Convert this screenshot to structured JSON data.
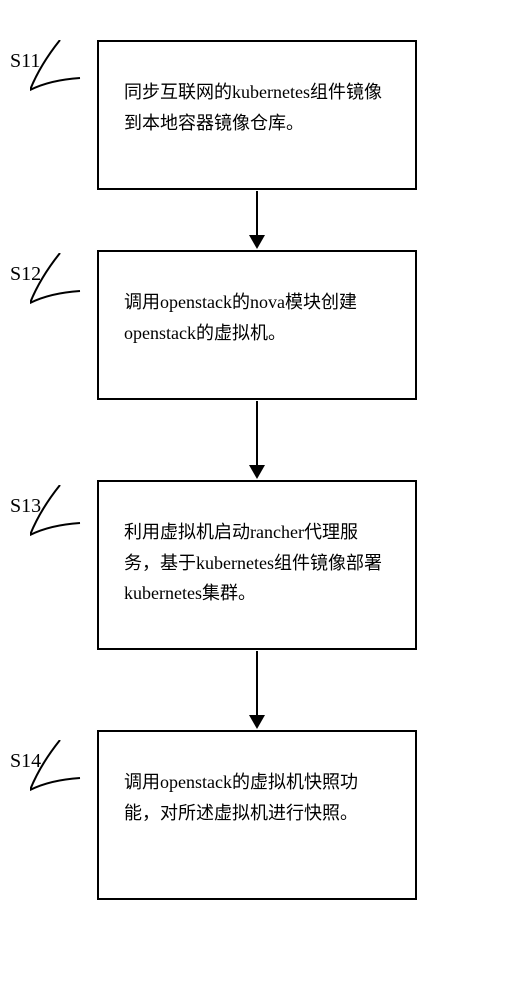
{
  "flowchart": {
    "steps": [
      {
        "id": "S11",
        "text": "同步互联网的kubernetes组件镜像到本地容器镜像仓库。"
      },
      {
        "id": "S12",
        "text": "调用openstack的nova模块创建openstack的虚拟机。"
      },
      {
        "id": "S13",
        "text": "利用虚拟机启动rancher代理服务，基于kubernetes组件镜像部署kubernetes集群。"
      },
      {
        "id": "S14",
        "text": "调用openstack的虚拟机快照功能，对所述虚拟机进行快照。"
      }
    ]
  }
}
